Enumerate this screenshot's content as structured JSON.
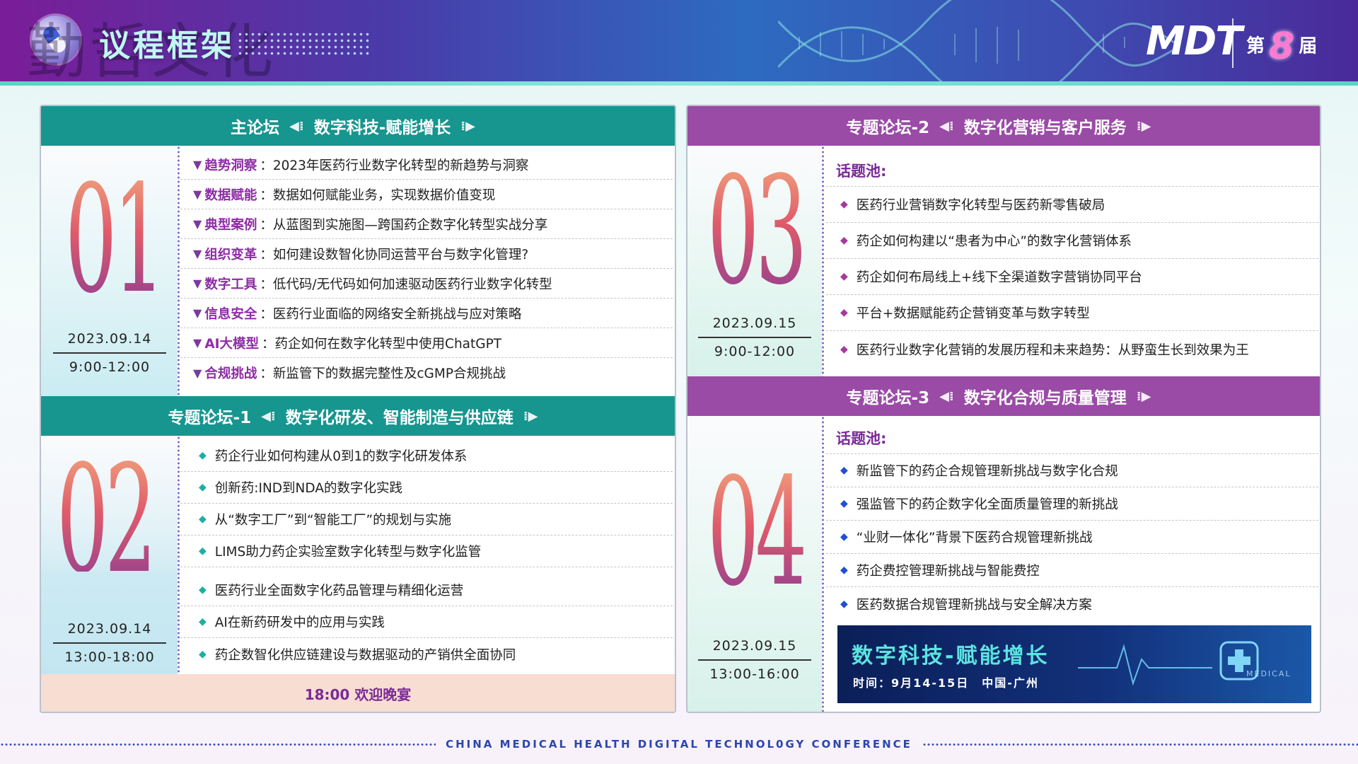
{
  "header": {
    "title": "议程框架",
    "watermark": "勤哲文化",
    "brand": "MDT",
    "edition_prefix": "第",
    "edition_num": "8",
    "edition_suffix": "届"
  },
  "main_forum": {
    "title": "主论坛",
    "subtitle": "数字科技-赋能增长",
    "number": "01",
    "date": "2023.09.14",
    "time": "9:00-12:00",
    "items": [
      {
        "key": "趋势洞察",
        "text": "2023年医药行业数字化转型的新趋势与洞察"
      },
      {
        "key": "数据赋能",
        "text": "数据如何赋能业务，实现数据价值变现"
      },
      {
        "key": "典型案例",
        "text": "从蓝图到实施图—跨国药企数字化转型实战分享"
      },
      {
        "key": "组织变革",
        "text": "如何建设数智化协同运营平台与数字化管理?"
      },
      {
        "key": "数字工具",
        "text": "低代码/无代码如何加速驱动医药行业数字化转型"
      },
      {
        "key": "信息安全",
        "text": "医药行业面临的网络安全新挑战与应对策略"
      },
      {
        "key": "AI大模型",
        "text": "药企如何在数字化转型中使用ChatGPT"
      },
      {
        "key": "合规挑战",
        "text": "新监管下的数据完整性及cGMP合规挑战"
      }
    ]
  },
  "forum1": {
    "title": "专题论坛-1",
    "subtitle": "数字化研发、智能制造与供应链",
    "number": "02",
    "date": "2023.09.14",
    "time": "13:00-18:00",
    "items": [
      "药企行业如何构建从0到1的数字化研发体系",
      "创新药:IND到NDA的数字化实践",
      "从“数字工厂”到“智能工厂”的规划与实施",
      "LIMS助力药企实验室数字化转型与数字化监管",
      "医药行业全面数字化药品管理与精细化运营",
      "AI在新药研发中的应用与实践",
      "药企数智化供应链建设与数据驱动的产销供全面协同"
    ],
    "dinner": "18:00 欢迎晚宴"
  },
  "forum2": {
    "title": "专题论坛-2",
    "subtitle": "数字化营销与客户服务",
    "number": "03",
    "date": "2023.09.15",
    "time": "9:00-12:00",
    "pool_label": "话题池:",
    "items": [
      "医药行业营销数字化转型与医药新零售破局",
      "药企如何构建以“患者为中心”的数字化营销体系",
      "药企如何布局线上+线下全渠道数字营销协同平台",
      "平台+数据赋能药企营销变革与数字转型",
      "医药行业数字化营销的发展历程和未来趋势：从野蛮生长到效果为王"
    ]
  },
  "forum3": {
    "title": "专题论坛-3",
    "subtitle": "数字化合规与质量管理",
    "number": "04",
    "date": "2023.09.15",
    "time": "13:00-16:00",
    "pool_label": "话题池:",
    "items": [
      "新监管下的药企合规管理新挑战与数字化合规",
      "强监管下的药企数字化全面质量管理的新挑战",
      "“业财一体化”背景下医药合规管理新挑战",
      "药企费控管理新挑战与智能费控",
      "医药数据合规管理新挑战与安全解决方案"
    ]
  },
  "banner": {
    "title": "数字科技-赋能增长",
    "info": "时间：9月14-15日　中国-广州",
    "tag": "MEDICAL"
  },
  "footer": {
    "text": "CHINA MEDICAL HEALTH DIGITAL TECHNOL0GY CONFERENCE"
  },
  "colors": {
    "teal": "#17958f",
    "purple": "#9a4ba6",
    "accent_magenta": "#8e2ca5",
    "dinner_bg": "#f8ddd3"
  }
}
